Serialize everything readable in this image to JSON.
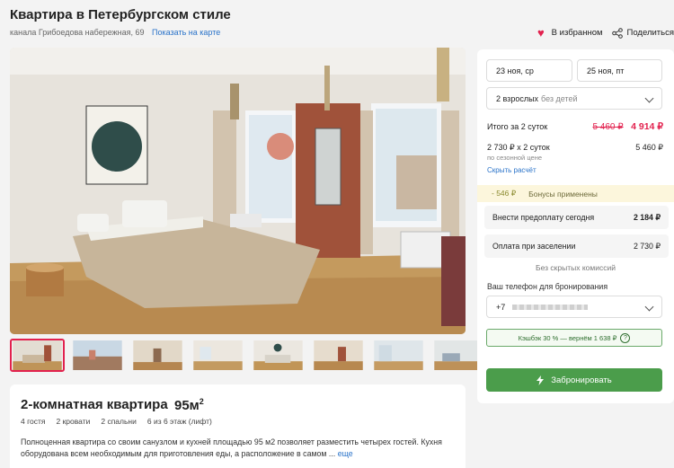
{
  "header": {
    "title": "Квартира в Петербургском стиле",
    "address": "канала Грибоедова набережная, 69",
    "map_link": "Показать на карте",
    "favorite_label": "В избранном",
    "share_label": "Поделиться"
  },
  "gallery": {
    "thumbnails": 8
  },
  "listing": {
    "room_type": "2-комнатная квартира",
    "area": "95м",
    "area_sup": "2",
    "features": [
      "4 гостя",
      "2 кровати",
      "2 спальни",
      "6 из 6 этаж (лифт)"
    ],
    "description": "Полноценная квартира со своим санузлом и кухней площадью 95 м2 позволяет разместить четырех гостей. Кухня оборудована всем необходимым для приготовления еды, а расположение в самом ...",
    "more_link": "еще"
  },
  "booking": {
    "checkin": "23 ноя, ср",
    "checkout": "25 ноя, пт",
    "guests": "2 взрослых",
    "guests_note": "без детей",
    "total_label": "Итого за 2 суток",
    "old_price": "5 460 ₽",
    "new_price": "4 914 ₽",
    "nightly_label": "2 730 ₽ x 2 суток",
    "nightly_total": "5 460 ₽",
    "seasonal_note": "по сезонной цене",
    "breakdown_link": "Скрыть расчёт",
    "discount": "- 546 ₽",
    "bonus_label": "Бонусы применены",
    "prepay_label": "Внести предоплату сегодня",
    "prepay_value": "2 184 ₽",
    "checkin_pay_label": "Оплата при заселении",
    "checkin_pay_value": "2 730 ₽",
    "no_fees": "Без скрытых комиссий",
    "phone_label": "Ваш телефон для бронирования",
    "phone_prefix": "+7",
    "cashback": "Кэшбэк 30 % — вернём 1 638 ₽",
    "cashback_help": "?",
    "book_button": "Забронировать"
  },
  "colors": {
    "accent": "#e2214e",
    "link": "#2a73c9",
    "book": "#4b9d4b"
  }
}
